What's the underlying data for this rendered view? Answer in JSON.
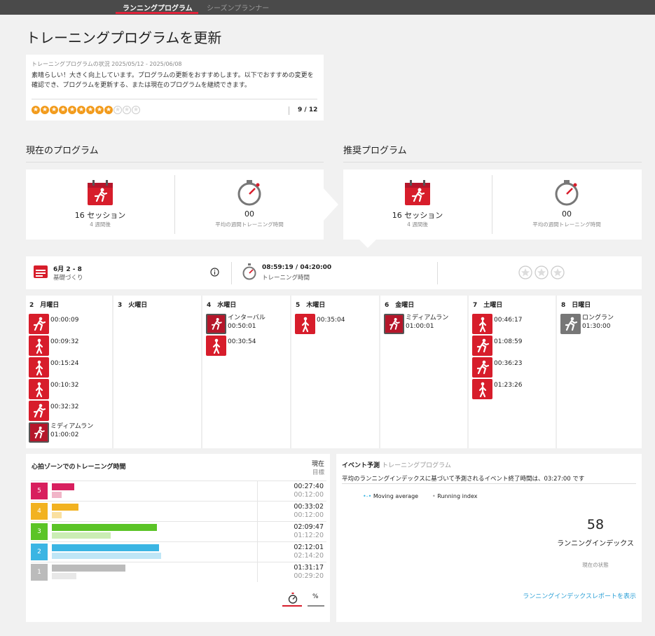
{
  "tabs": {
    "program": "ランニングプログラム",
    "planner": "シーズンプランナー"
  },
  "page_title": "トレーニングプログラムを更新",
  "status": {
    "subtitle": "トレーニングプログラムの状況 2025/05/12 - 2025/06/08",
    "message": "素晴らしい！大きく向上しています。プログラムの更新をおすすめします。以下でおすすめの変更を確認でき、プログラムを更新する、または現在のプログラムを継続できます。",
    "score": "9 / 12",
    "stars_filled": 9,
    "stars_total": 12
  },
  "current": {
    "title": "現在のプログラム",
    "sessions": "16 セッション",
    "sessions_sub": "4 週間後",
    "avg": "00",
    "avg_sub": "平均の週間トレーニング時間"
  },
  "recommended": {
    "title": "推奨プログラム",
    "sessions": "16 セッション",
    "sessions_sub": "4 週間後",
    "avg": "00",
    "avg_sub": "平均の週間トレーニング時間"
  },
  "week": {
    "dates": "6月 2 - 8",
    "phase": "基礎づくり",
    "time": "08:59:19 / 04:20:00",
    "time_label": "トレーニング時間",
    "info_icon": "info-icon"
  },
  "days": [
    {
      "label": "2　月曜日",
      "workouts": [
        {
          "type": "run",
          "text": "00:00:09"
        },
        {
          "type": "walk",
          "text": "00:09:32"
        },
        {
          "type": "walk",
          "text": "00:15:24"
        },
        {
          "type": "walk",
          "text": "00:10:32"
        },
        {
          "type": "run",
          "text": "00:32:32"
        },
        {
          "type": "run-dark",
          "name": "ミディアムラン",
          "text": "01:00:02"
        }
      ]
    },
    {
      "label": "3　火曜日",
      "workouts": []
    },
    {
      "label": "4　水曜日",
      "workouts": [
        {
          "type": "run-dark",
          "name": "インターバル",
          "text": "00:50:01"
        },
        {
          "type": "walk",
          "text": "00:30:54"
        }
      ]
    },
    {
      "label": "5　木曜日",
      "workouts": [
        {
          "type": "walk",
          "text": "00:35:04"
        }
      ]
    },
    {
      "label": "6　金曜日",
      "workouts": [
        {
          "type": "run-dark",
          "name": "ミディアムラン",
          "text": "01:00:01"
        }
      ]
    },
    {
      "label": "7　土曜日",
      "workouts": [
        {
          "type": "walk",
          "text": "00:46:17"
        },
        {
          "type": "run",
          "text": "01:08:59"
        },
        {
          "type": "run",
          "text": "00:36:23"
        },
        {
          "type": "walk",
          "text": "01:23:26"
        }
      ]
    },
    {
      "label": "8　日曜日",
      "workouts": [
        {
          "type": "run-grey",
          "name": "ロングラン",
          "text": "01:30:00"
        }
      ]
    }
  ],
  "hr_zones": {
    "title": "心拍ゾーンでのトレーニング時間",
    "now_label": "現在",
    "target_label": "目標",
    "zones": [
      {
        "num": "5",
        "color": "#d81f5e",
        "light": "#f1b5c8",
        "current": "00:27:40",
        "target": "00:12:00",
        "cur_frac": 0.21,
        "tgt_frac": 0.09
      },
      {
        "num": "4",
        "color": "#f2b220",
        "light": "#fae0a0",
        "current": "00:33:02",
        "target": "00:12:00",
        "cur_frac": 0.25,
        "tgt_frac": 0.09
      },
      {
        "num": "3",
        "color": "#5bc427",
        "light": "#cbedb5",
        "current": "02:09:47",
        "target": "01:12:20",
        "cur_frac": 1.0,
        "tgt_frac": 0.56
      },
      {
        "num": "2",
        "color": "#3bb5e3",
        "light": "#bfe6f6",
        "current": "02:12:01",
        "target": "02:14:20",
        "cur_frac": 1.02,
        "tgt_frac": 1.04
      },
      {
        "num": "1",
        "color": "#bbbbbb",
        "light": "#e8e8e8",
        "current": "01:31:17",
        "target": "00:29:20",
        "cur_frac": 0.7,
        "tgt_frac": 0.23
      }
    ],
    "unit_percent": "%"
  },
  "event": {
    "title": "イベント予測",
    "title_sub": "トレーニングプログラム",
    "desc": "平均のランニングインデックスに基づいて予測されるイベント終了時間は、03:27:00 です",
    "legend_ma": "Moving average",
    "legend_ri": "Running index",
    "ri_value": "58",
    "ri_label": "ランニングインデックス",
    "ri_sub": "現在の状態",
    "link": "ランニングインデックスレポートを表示"
  }
}
